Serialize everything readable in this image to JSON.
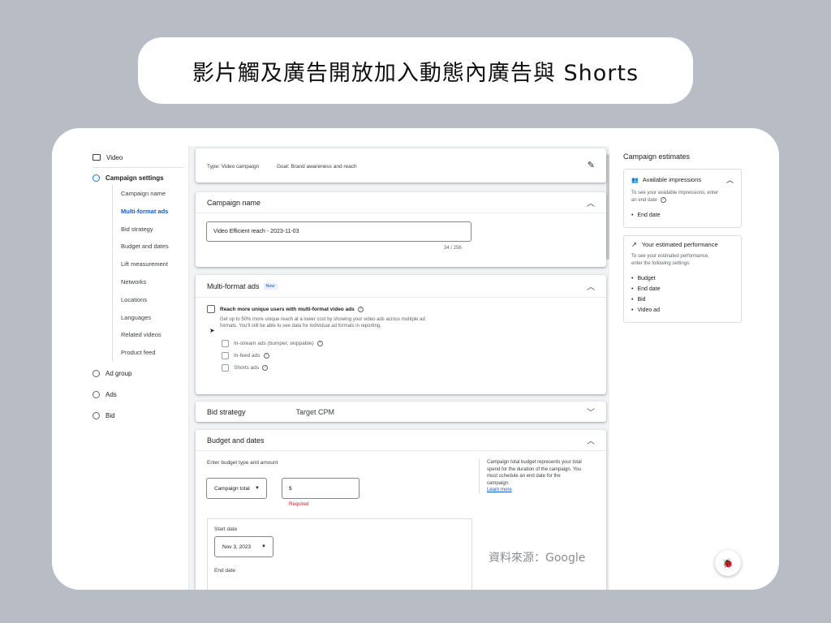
{
  "title": "影片觸及廣告開放加入動態內廣告與 Shorts",
  "nav": {
    "video": "Video",
    "campaign_settings": "Campaign settings",
    "sub_items": [
      "Campaign name",
      "Multi-format ads",
      "Bid strategy",
      "Budget and dates",
      "Lift measurement",
      "Networks",
      "Locations",
      "Languages",
      "Related videos",
      "Product feed"
    ],
    "ad_group": "Ad group",
    "ads": "Ads",
    "bid": "Bid"
  },
  "summary": {
    "type": "Type: Video campaign",
    "goal": "Goal: Brand awareness and reach"
  },
  "campaign_name": {
    "header": "Campaign name",
    "value": "Video Efficient reach - 2023-11-03",
    "counter": "34 / 256"
  },
  "multiformat": {
    "header": "Multi-format ads",
    "badge": "New",
    "checkbox_label": "Reach more unique users with multi-format video ads",
    "description_1": "Get up to 50% more unique reach at a lower cost by showing your video ads across multiple ad",
    "description_2": "formats. You'll still be able to see data for individual ad formats in reporting.",
    "options": [
      "In-stream ads (bumper, skippable)",
      "In-feed ads",
      "Shorts ads"
    ]
  },
  "bid_strategy": {
    "header": "Bid strategy",
    "value": "Target CPM"
  },
  "budget": {
    "header": "Budget and dates",
    "prompt": "Enter budget type and amount",
    "type_value": "Campaign total",
    "currency": "$",
    "required": "Required",
    "info": [
      "Campaign total budget represents your total",
      "spend for the duration of the campaign. You",
      "must schedule an end date for the",
      "campaign."
    ],
    "learn_more": "Learn more",
    "start_label": "Start date",
    "start_value": "Nov 3, 2023",
    "end_label": "End date"
  },
  "estimates": {
    "title": "Campaign estimates",
    "impressions": {
      "header": "Available impressions",
      "desc_1": "To see your available impressions, enter",
      "desc_2": "an end date",
      "items": [
        "End date"
      ]
    },
    "performance": {
      "header": "Your estimated performance",
      "desc_1": "To see your estimated performance,",
      "desc_2": "enter the following settings:",
      "items": [
        "Budget",
        "End date",
        "Bid",
        "Video ad"
      ]
    }
  },
  "source": "資料來源：Google",
  "colors": {
    "accent": "#1a73e8",
    "link": "#1a57c7",
    "error": "#c5221f"
  }
}
